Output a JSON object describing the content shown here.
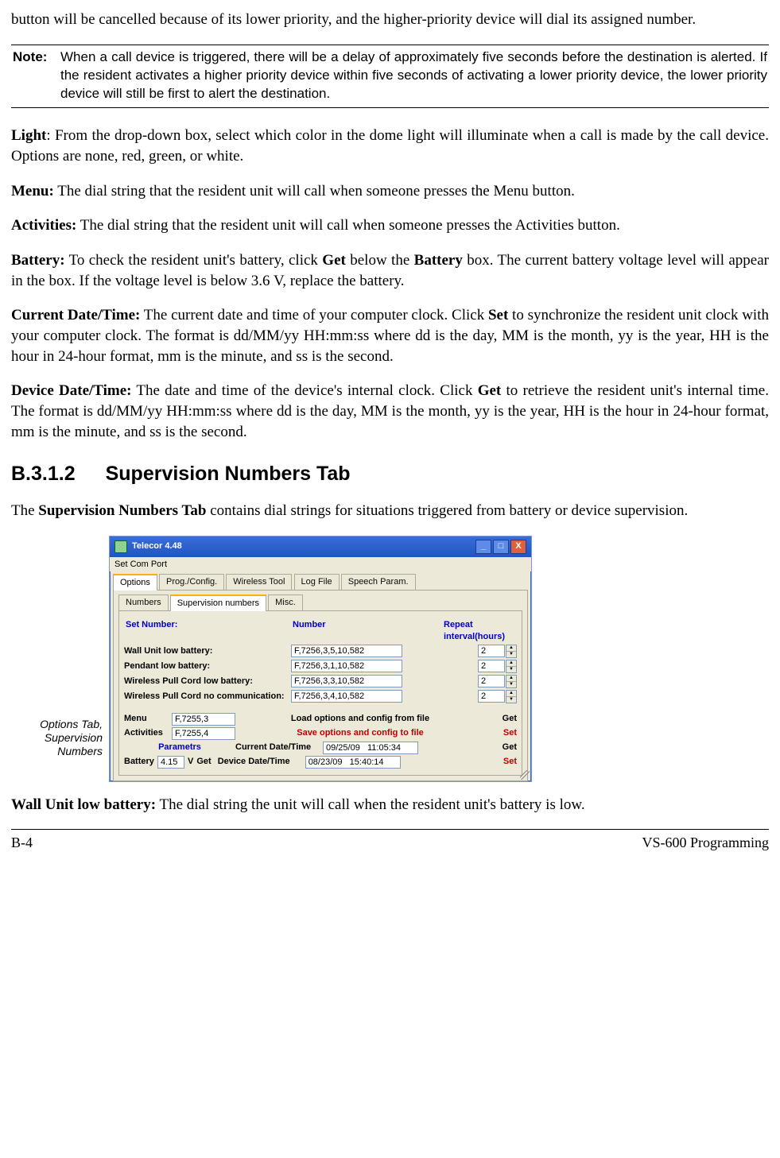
{
  "intro": "button will be cancelled because of its lower priority, and the higher-priority device will dial its assigned number.",
  "note": {
    "label": "Note:",
    "text": "When a call device is triggered, there will be a delay of approximately five seconds before the destination is alerted. If the resident activates a higher priority device within five seconds of activating a lower priority device, the lower priority device will still be first to alert the destination."
  },
  "para_light_pre": "Light",
  "para_light": ": From the drop-down box, select which color in the dome light will illuminate when a call is made by the call device. Options are none, red, green, or white.",
  "para_menu_pre": "Menu:",
  "para_menu": " The dial string that the resident unit will call when someone presses the Menu button.",
  "para_act_pre": "Activities:",
  "para_act": " The dial string that the resident unit will call when someone presses the Activities button.",
  "para_bat_pre": "Battery:",
  "para_bat_mid1": " To check the resident unit's battery, click ",
  "para_bat_get": "Get",
  "para_bat_mid2": " below the ",
  "para_bat_b": "Battery",
  "para_bat_end": " box.  The current battery voltage level will appear in the box.  If the voltage level is below 3.6 V, replace the battery.",
  "para_cdt_pre": "Current Date/Time:",
  "para_cdt_mid1": " The current date and time of your computer clock.  Click ",
  "para_cdt_set": "Set",
  "para_cdt_end": " to synchronize the resident unit clock with your computer clock.  The format is dd/MM/yy HH:mm:ss where dd is the day, MM is the month, yy is the year, HH is the hour in 24-hour format, mm is the minute, and ss is the second.",
  "para_ddt_pre": "Device Date/Time:",
  "para_ddt_mid1": " The date and time of the device's internal clock. Click ",
  "para_ddt_get": "Get",
  "para_ddt_end": " to retrieve the resident unit's internal time.  The format is dd/MM/yy HH:mm:ss where dd is the day, MM is the month, yy is the year, HH is the hour in 24-hour format, mm is the minute, and ss is the second.",
  "section": {
    "num": "B.3.1.2",
    "title": "Supervision Numbers Tab"
  },
  "para_sn_pre": "The ",
  "para_sn_b": "Supervision Numbers Tab",
  "para_sn_end": " contains dial strings for situations triggered from battery or device supervision.",
  "fig_caption": "Options Tab, Supervision Numbers",
  "win": {
    "title": "Telecor 4.48",
    "menubar": "Set Com Port",
    "tabs1": [
      "Options",
      "Prog./Config.",
      "Wireless Tool",
      "Log File",
      "Speech Param."
    ],
    "tabs2": [
      "Numbers",
      "Supervision numbers",
      "Misc."
    ],
    "headers": {
      "col1": "Set Number:",
      "col2": "Number",
      "col3": "Repeat interval(hours)"
    },
    "rows": [
      {
        "label": "Wall Unit low battery:",
        "number": "F,7256,3,5,10,582",
        "repeat": "2"
      },
      {
        "label": "Pendant low battery:",
        "number": "F,7256,3,1,10,582",
        "repeat": "2"
      },
      {
        "label": "Wireless Pull Cord low battery:",
        "number": "F,7256,3,3,10,582",
        "repeat": "2"
      },
      {
        "label": "Wireless Pull Cord no communication:",
        "number": "F,7256,3,4,10,582",
        "repeat": "2"
      }
    ],
    "bottom": {
      "menu_label": "Menu",
      "menu_val": "F,7255,3",
      "act_label": "Activities",
      "act_val": "F,7255,4",
      "load_text": "Load  options and config from file",
      "load_act": "Get",
      "save_text": "Save options and config to file",
      "save_act": "Set",
      "parametrs": "Parametrs",
      "battery_label": "Battery",
      "battery_val": "4.15",
      "v": "V",
      "bget": "Get",
      "cdt_label": "Current Date/Time",
      "cdt_val": "09/25/09   11:05:34",
      "cdt_act": "Get",
      "ddt_label": "Device Date/Time",
      "ddt_val": "08/23/09   15:40:14",
      "ddt_act": "Set"
    }
  },
  "para_wall_pre": "Wall Unit low battery:",
  "para_wall": " The dial string the unit will call when the resident unit's battery is low.",
  "footer": {
    "left": "B-4",
    "right": "VS-600 Programming"
  }
}
